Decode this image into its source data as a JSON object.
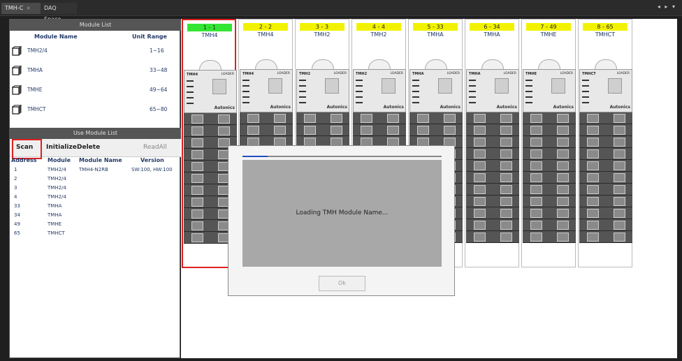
{
  "tabs": [
    {
      "label": "TMH-C",
      "close": "×"
    },
    {
      "label": "DAQ Space"
    }
  ],
  "tab_controls": "◂ ▸ ▾",
  "module_list": {
    "title": "Module List",
    "col_name": "Module Name",
    "col_range": "Unit Range",
    "items": [
      {
        "name": "TMH2/4",
        "range": "1~16",
        "icon": "module-icon"
      },
      {
        "name": "TMHA",
        "range": "33~48",
        "icon": "module-icon"
      },
      {
        "name": "TMHE",
        "range": "49~64",
        "icon": "module-icon"
      },
      {
        "name": "TMHCT",
        "range": "65~80",
        "icon": "module-icon"
      }
    ]
  },
  "use_module_list": {
    "title": "Use Module List",
    "toolbar": {
      "scan": "Scan",
      "initialize": "Initialize",
      "delete": "Delete",
      "readall": "ReadAll"
    },
    "headers": {
      "address": "Address",
      "module": "Module",
      "module_name": "Module Name",
      "version": "Version"
    },
    "rows": [
      {
        "address": "1",
        "module": "TMH2/4",
        "module_name": "TMH4-N2RB",
        "version": "SW:100, HW:100"
      },
      {
        "address": "2",
        "module": "TMH2/4",
        "module_name": "",
        "version": ""
      },
      {
        "address": "3",
        "module": "TMH2/4",
        "module_name": "",
        "version": ""
      },
      {
        "address": "4",
        "module": "TMH2/4",
        "module_name": "",
        "version": ""
      },
      {
        "address": "33",
        "module": "TMHA",
        "module_name": "",
        "version": ""
      },
      {
        "address": "34",
        "module": "TMHA",
        "module_name": "",
        "version": ""
      },
      {
        "address": "49",
        "module": "TMHE",
        "module_name": "",
        "version": ""
      },
      {
        "address": "65",
        "module": "TMHCT",
        "module_name": "",
        "version": ""
      }
    ]
  },
  "cards": [
    {
      "badge": "1 - 1",
      "title": "TMH4",
      "model": "TMH4",
      "brand": "Autonics",
      "loader": "LOADER",
      "badge_color": "#33e633",
      "selected": true
    },
    {
      "badge": "2 - 2",
      "title": "TMH4",
      "model": "TMH4",
      "brand": "Autonics",
      "loader": "LOADER",
      "badge_color": "#f2f200",
      "selected": false
    },
    {
      "badge": "3 - 3",
      "title": "TMH2",
      "model": "TMH2",
      "brand": "Autonics",
      "loader": "LOADER",
      "badge_color": "#f2f200",
      "selected": false
    },
    {
      "badge": "4 - 4",
      "title": "TMH2",
      "model": "TMH2",
      "brand": "Autonics",
      "loader": "LOADER",
      "badge_color": "#f2f200",
      "selected": false
    },
    {
      "badge": "5 - 33",
      "title": "TMHA",
      "model": "TMHA",
      "brand": "Autonics",
      "loader": "LOADER",
      "badge_color": "#f2f200",
      "selected": false
    },
    {
      "badge": "6 - 34",
      "title": "TMHA",
      "model": "TMHA",
      "brand": "Autonics",
      "loader": "LOADER",
      "badge_color": "#f2f200",
      "selected": false
    },
    {
      "badge": "7 - 49",
      "title": "TMHE",
      "model": "TMHE",
      "brand": "Autonics",
      "loader": "LOADER",
      "badge_color": "#f2f200",
      "selected": false
    },
    {
      "badge": "8 - 65",
      "title": "TMHCT",
      "model": "TMHCT",
      "brand": "Autonics",
      "loader": "LOADER",
      "badge_color": "#f2f200",
      "selected": false
    }
  ],
  "dialog": {
    "message": "Loading TMH Module Name...",
    "ok": "Ok"
  },
  "colors": {
    "highlight_red": "#e02020",
    "badge_green": "#33e633",
    "badge_yellow": "#f2f200",
    "text_blue": "#243a67"
  }
}
